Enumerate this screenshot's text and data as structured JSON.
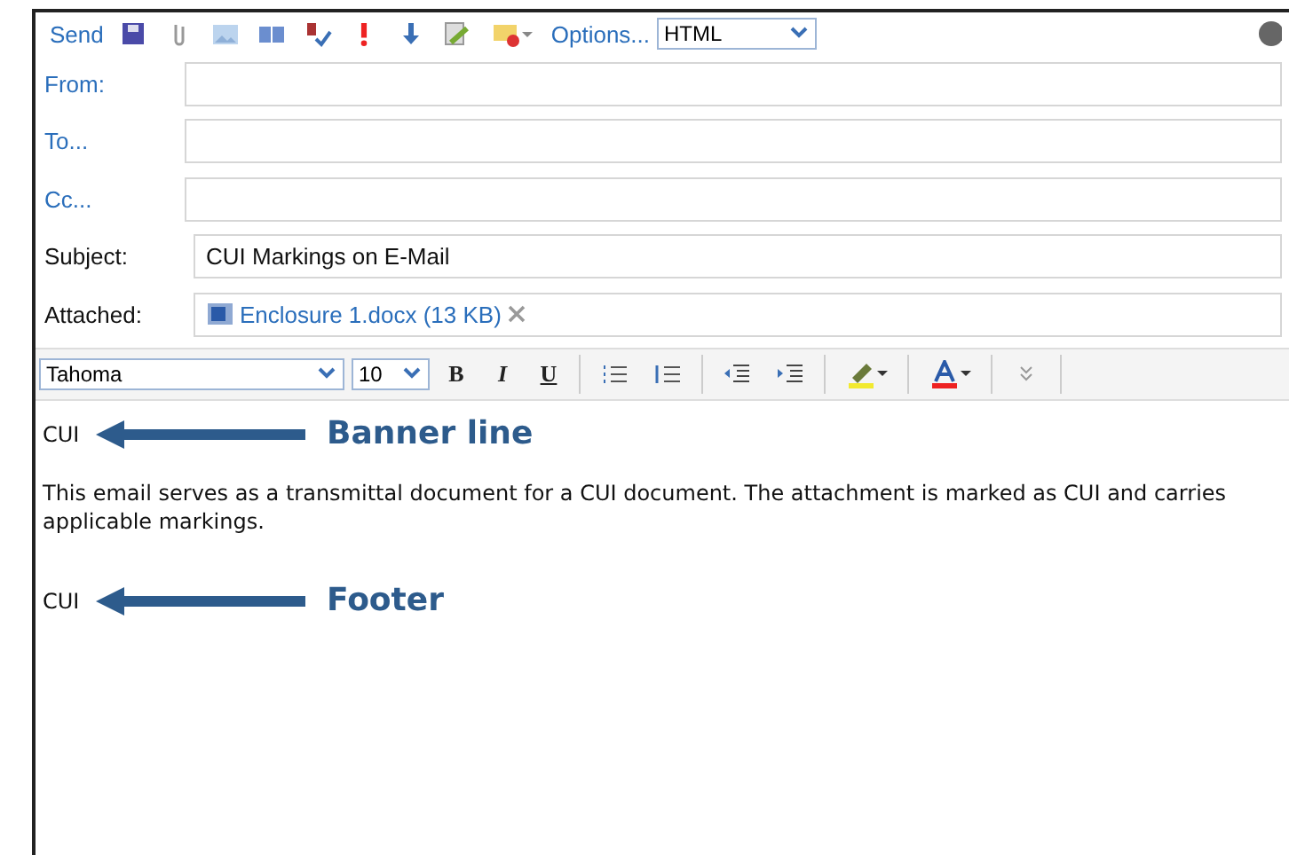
{
  "toolbar": {
    "send": "Send",
    "options": "Options...",
    "format": "HTML"
  },
  "fields": [
    {
      "label": "From:",
      "kind": "link"
    },
    {
      "label": "To...",
      "kind": "link"
    },
    {
      "label": "Cc...",
      "kind": "link"
    },
    {
      "label": "Subject:",
      "kind": "plain",
      "value": "CUI Markings on E-Mail"
    }
  ],
  "attached": {
    "label": "Attached:",
    "file": "Enclosure 1.docx (13 KB)"
  },
  "format_bar": {
    "font": "Tahoma",
    "size": "10",
    "styles": [
      "B",
      "I",
      "U"
    ]
  },
  "body": [
    {
      "kind": "marking",
      "text": "CUI",
      "callout": "Banner line"
    },
    {
      "kind": "paragraph",
      "text": "This email serves as a transmittal document for a CUI document.  The attachment is marked as CUI and carries applicable markings."
    },
    {
      "kind": "marking",
      "text": "CUI",
      "callout": "Footer"
    }
  ]
}
